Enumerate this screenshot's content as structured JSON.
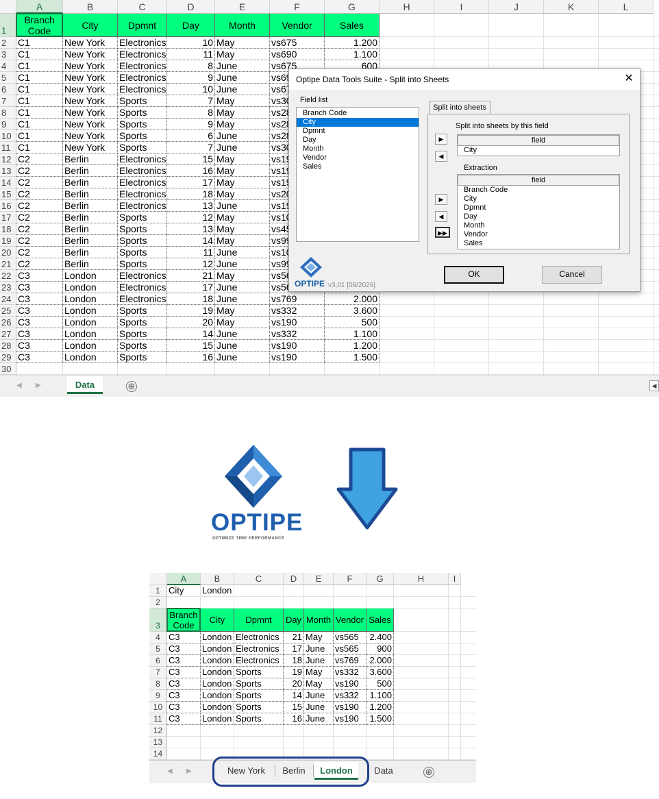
{
  "top_sheet": {
    "columns": [
      "A",
      "B",
      "C",
      "D",
      "E",
      "F",
      "G",
      "H",
      "I",
      "J",
      "K",
      "L"
    ],
    "headers": [
      "Branch Code",
      "City",
      "Dpmnt",
      "Day",
      "Month",
      "Vendor",
      "Sales"
    ],
    "rows": [
      [
        "C1",
        "New York",
        "Electronics",
        "10",
        "May",
        "vs675",
        "1.200"
      ],
      [
        "C1",
        "New York",
        "Electronics",
        "11",
        "May",
        "vs690",
        "1.100"
      ],
      [
        "C1",
        "New York",
        "Electronics",
        "8",
        "June",
        "vs675",
        "600"
      ],
      [
        "C1",
        "New York",
        "Electronics",
        "9",
        "June",
        "vs69",
        ""
      ],
      [
        "C1",
        "New York",
        "Electronics",
        "10",
        "June",
        "vs67",
        ""
      ],
      [
        "C1",
        "New York",
        "Sports",
        "7",
        "May",
        "vs30",
        ""
      ],
      [
        "C1",
        "New York",
        "Sports",
        "8",
        "May",
        "vs28",
        ""
      ],
      [
        "C1",
        "New York",
        "Sports",
        "9",
        "May",
        "vs28",
        ""
      ],
      [
        "C1",
        "New York",
        "Sports",
        "6",
        "June",
        "vs28",
        ""
      ],
      [
        "C1",
        "New York",
        "Sports",
        "7",
        "June",
        "vs30",
        ""
      ],
      [
        "C2",
        "Berlin",
        "Electronics",
        "15",
        "May",
        "vs19",
        ""
      ],
      [
        "C2",
        "Berlin",
        "Electronics",
        "16",
        "May",
        "vs19",
        ""
      ],
      [
        "C2",
        "Berlin",
        "Electronics",
        "17",
        "May",
        "vs19",
        ""
      ],
      [
        "C2",
        "Berlin",
        "Electronics",
        "18",
        "May",
        "vs20",
        ""
      ],
      [
        "C2",
        "Berlin",
        "Electronics",
        "13",
        "June",
        "vs19",
        ""
      ],
      [
        "C2",
        "Berlin",
        "Sports",
        "12",
        "May",
        "vs10",
        ""
      ],
      [
        "C2",
        "Berlin",
        "Sports",
        "13",
        "May",
        "vs45",
        ""
      ],
      [
        "C2",
        "Berlin",
        "Sports",
        "14",
        "May",
        "vs99",
        ""
      ],
      [
        "C2",
        "Berlin",
        "Sports",
        "11",
        "June",
        "vs10",
        ""
      ],
      [
        "C2",
        "Berlin",
        "Sports",
        "12",
        "June",
        "vs99",
        ""
      ],
      [
        "C3",
        "London",
        "Electronics",
        "21",
        "May",
        "vs56",
        ""
      ],
      [
        "C3",
        "London",
        "Electronics",
        "17",
        "June",
        "vs56",
        ""
      ],
      [
        "C3",
        "London",
        "Electronics",
        "18",
        "June",
        "vs769",
        "2.000"
      ],
      [
        "C3",
        "London",
        "Sports",
        "19",
        "May",
        "vs332",
        "3.600"
      ],
      [
        "C3",
        "London",
        "Sports",
        "20",
        "May",
        "vs190",
        "500"
      ],
      [
        "C3",
        "London",
        "Sports",
        "14",
        "June",
        "vs332",
        "1.100"
      ],
      [
        "C3",
        "London",
        "Sports",
        "15",
        "June",
        "vs190",
        "1.200"
      ],
      [
        "C3",
        "London",
        "Sports",
        "16",
        "June",
        "vs190",
        "1.500"
      ]
    ],
    "row_numbers": [
      "1",
      "2",
      "3",
      "4",
      "5",
      "6",
      "7",
      "8",
      "9",
      "10",
      "11",
      "12",
      "13",
      "14",
      "15",
      "16",
      "17",
      "18",
      "19",
      "20",
      "21",
      "22",
      "23",
      "24",
      "25",
      "26",
      "27",
      "28",
      "29",
      "30"
    ],
    "tab": "Data",
    "add_sheet": "⊕"
  },
  "dialog": {
    "title": "Optipe Data Tools Suite - Split into Sheets",
    "close": "✕",
    "field_list_label": "Field list",
    "field_list": [
      "Branch Code",
      "City",
      "Dpmnt",
      "Day",
      "Month",
      "Vendor",
      "Sales"
    ],
    "selected_field": "City",
    "tab_label": "Split into sheets",
    "split_label": "Split into sheets by this field",
    "split_field_header": "field",
    "split_field_value": "City",
    "extraction_label": "Extraction",
    "extraction_header": "field",
    "extraction_items": [
      "Branch Code",
      "City",
      "Dpmnt",
      "Day",
      "Month",
      "Vendor",
      "Sales"
    ],
    "logo_text": "OPTIPE",
    "version": "v3,01 [08/2026]",
    "ok": "OK",
    "cancel": "Cancel"
  },
  "logo": {
    "name": "OPTIPE",
    "tagline": "OPTIMIZE TIME PERFORMANCE"
  },
  "colors": {
    "header_fill": "#00ff7f",
    "excel_green": "#217346",
    "arrow_fill": "#3ea3e0",
    "arrow_stroke": "#1c4a94"
  },
  "bottom_sheet": {
    "columns": [
      "A",
      "B",
      "C",
      "D",
      "E",
      "F",
      "G",
      "H",
      "I"
    ],
    "row_numbers": [
      "1",
      "2",
      "3",
      "4",
      "5",
      "6",
      "7",
      "8",
      "9",
      "10",
      "11",
      "12",
      "13",
      "14"
    ],
    "a1": "City",
    "b1": "London",
    "headers": [
      "Branch Code",
      "City",
      "Dpmnt",
      "Day",
      "Month",
      "Vendor",
      "Sales"
    ],
    "rows": [
      [
        "C3",
        "London",
        "Electronics",
        "21",
        "May",
        "vs565",
        "2.400"
      ],
      [
        "C3",
        "London",
        "Electronics",
        "17",
        "June",
        "vs565",
        "900"
      ],
      [
        "C3",
        "London",
        "Electronics",
        "18",
        "June",
        "vs769",
        "2.000"
      ],
      [
        "C3",
        "London",
        "Sports",
        "19",
        "May",
        "vs332",
        "3.600"
      ],
      [
        "C3",
        "London",
        "Sports",
        "20",
        "May",
        "vs190",
        "500"
      ],
      [
        "C3",
        "London",
        "Sports",
        "14",
        "June",
        "vs332",
        "1.100"
      ],
      [
        "C3",
        "London",
        "Sports",
        "15",
        "June",
        "vs190",
        "1.200"
      ],
      [
        "C3",
        "London",
        "Sports",
        "16",
        "June",
        "vs190",
        "1.500"
      ]
    ],
    "tabs": [
      "New York",
      "Berlin",
      "London",
      "Data"
    ],
    "active_tab": "London",
    "add_sheet": "⊕"
  }
}
